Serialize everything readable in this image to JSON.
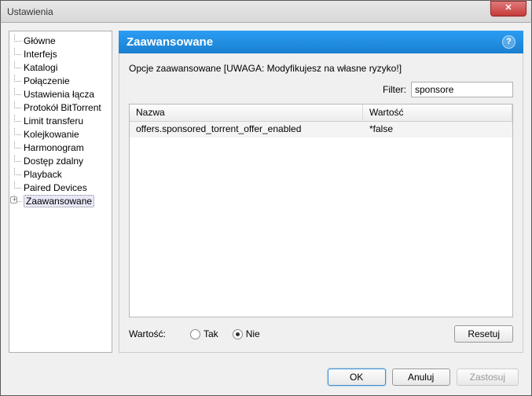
{
  "window": {
    "title": "Ustawienia",
    "close_glyph": "✕"
  },
  "tree": {
    "items": [
      {
        "label": "Główne"
      },
      {
        "label": "Interfejs"
      },
      {
        "label": "Katalogi"
      },
      {
        "label": "Połączenie"
      },
      {
        "label": "Ustawienia łącza"
      },
      {
        "label": "Protokół BitTorrent"
      },
      {
        "label": "Limit transferu"
      },
      {
        "label": "Kolejkowanie"
      },
      {
        "label": "Harmonogram"
      },
      {
        "label": "Dostęp zdalny"
      },
      {
        "label": "Playback"
      },
      {
        "label": "Paired Devices"
      },
      {
        "label": "Zaawansowane",
        "selected": true,
        "expandable": true
      }
    ]
  },
  "panel": {
    "heading": "Zaawansowane",
    "help_glyph": "?",
    "warning": "Opcje zaawansowane [UWAGA: Modyfikujesz na własne ryzyko!]",
    "filter_label": "Filter:",
    "filter_value": "sponsore",
    "columns": {
      "name": "Nazwa",
      "value": "Wartość"
    },
    "rows": [
      {
        "name": "offers.sponsored_torrent_offer_enabled",
        "value": "*false"
      }
    ],
    "value_label": "Wartość:",
    "radio_yes": "Tak",
    "radio_no": "Nie",
    "reset": "Resetuj"
  },
  "dialog_buttons": {
    "ok": "OK",
    "cancel": "Anuluj",
    "apply": "Zastosuj"
  }
}
